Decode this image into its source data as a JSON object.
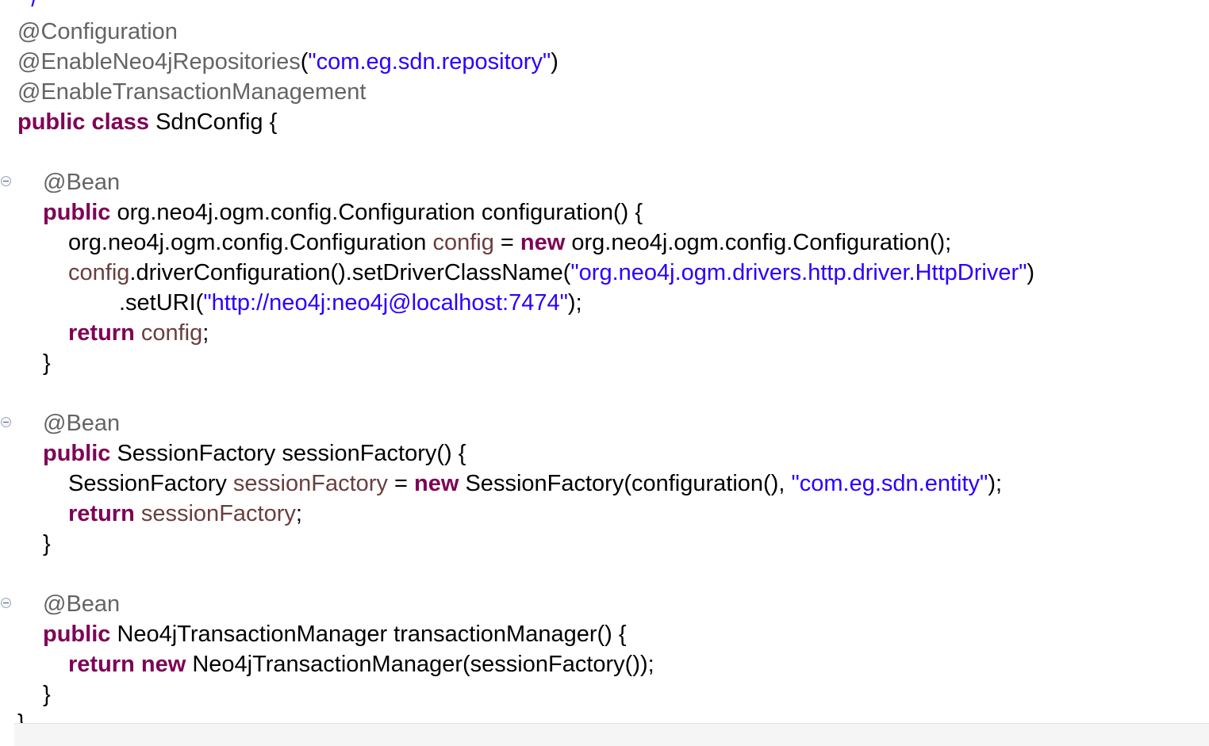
{
  "editor": {
    "comment_end": "*/",
    "ann_configuration": "@Configuration",
    "ann_enable_repos": "@EnableNeo4jRepositories",
    "str_repo_pkg": "\"com.eg.sdn.repository\"",
    "ann_enable_tx": "@EnableTransactionManagement",
    "kw_public": "public",
    "kw_class": "class",
    "class_name": "SdnConfig {",
    "ann_bean": "@Bean",
    "m1_sig": "org.neo4j.ogm.config.Configuration configuration() {",
    "m1_l1_type": "org.neo4j.ogm.config.Configuration",
    "var_config": "config",
    "kw_new": "new",
    "m1_l1_rhs": "org.neo4j.ogm.config.Configuration();",
    "m1_l2_call": ".driverConfiguration().setDriverClassName(",
    "str_driver": "\"org.neo4j.ogm.drivers.http.driver.HttpDriver\"",
    "m1_l3_call": ".setURI(",
    "str_uri": "\"http://neo4j:neo4j@localhost:7474\"",
    "kw_return": "return",
    "m2_sig": "SessionFactory sessionFactory() {",
    "m2_l1_type": "SessionFactory",
    "var_session_factory": "sessionFactory",
    "m2_l1_call": "SessionFactory(configuration(), ",
    "str_entity_pkg": "\"com.eg.sdn.entity\"",
    "m3_sig": "Neo4jTransactionManager transactionManager() {",
    "m3_l1_rest": "Neo4jTransactionManager(sessionFactory());",
    "close_brace": "}"
  }
}
